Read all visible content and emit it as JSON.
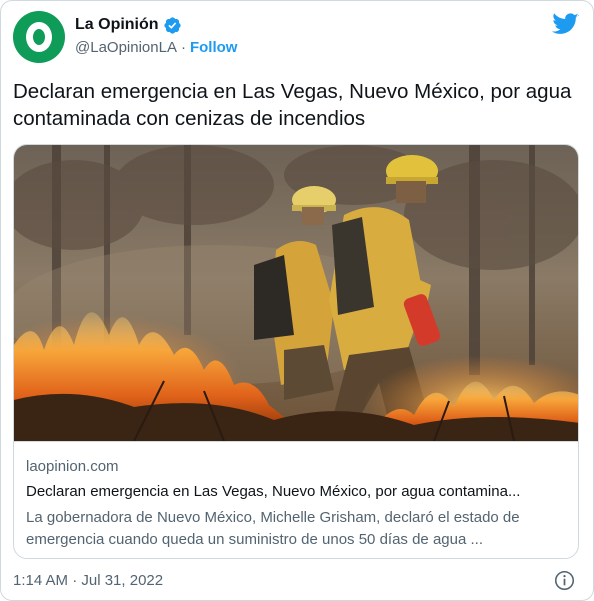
{
  "author": {
    "name": "La Opinión",
    "handle": "@LaOpinionLA",
    "separator": "·",
    "follow_label": "Follow",
    "avatar_color": "#0f9b58",
    "verified_icon": "verified-badge-icon"
  },
  "brand_icon": "twitter-bird-icon",
  "tweet": {
    "text": "Declaran emergencia en Las Vegas, Nuevo México, por agua contaminada con cenizas de incendios",
    "timestamp": "1:14 AM · Jul 31, 2022"
  },
  "card": {
    "image_subject": "firefighters-in-wildfire",
    "domain": "laopinion.com",
    "title": "Declaran emergencia en Las Vegas, Nuevo México, por agua contamina...",
    "description": "La gobernadora de Nuevo México, Michelle Grisham, declaró el estado de emergencia cuando queda un suministro de unos 50 días de agua ..."
  },
  "colors": {
    "accent": "#1d9bf0",
    "text_primary": "#0f1419",
    "text_secondary": "#536471",
    "border": "#cfd9de"
  },
  "info_icon": "info-icon"
}
